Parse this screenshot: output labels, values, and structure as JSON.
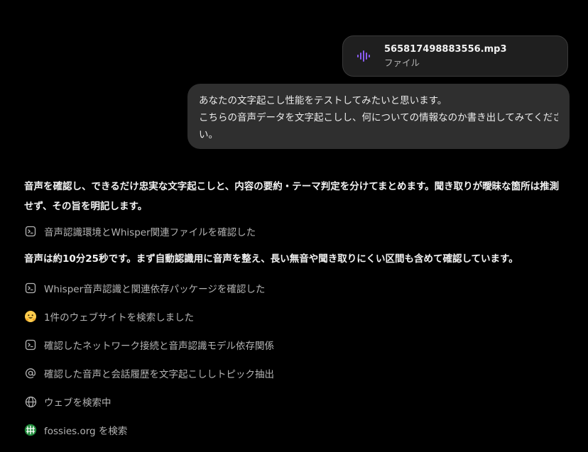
{
  "attachment": {
    "file_name": "565817498883556.mp3",
    "file_type": "ファイル",
    "icon": "audio-waveform-icon",
    "icon_color": "#8b5cf6"
  },
  "user_message": {
    "lines": [
      "あなたの文字起こし性能をテストしてみたいと思います。",
      "こちらの音声データを文字起こしし、何についての情報なのか書き出してみてくださ",
      "い。"
    ]
  },
  "assistant": {
    "intro_lines": [
      "音声を確認し、できるだけ忠実な文字起こしと、内容の要約・テーマ判定を分けてまとめます。聞き取りが曖昧な箇所は推測",
      "せず、その旨を明記します。"
    ],
    "duration_note": "音声は約10分25秒です。まず自動認識用に音声を整え、長い無音や聞き取りにくい区間も含めて確認しています。",
    "steps": [
      {
        "icon": "terminal-icon",
        "label": "音声認識環境とWhisper関連ファイルを確認した"
      },
      {
        "icon": "terminal-icon",
        "label": "Whisper音声認識と関連依存パッケージを確認した"
      },
      {
        "icon": "hugging-face-icon",
        "label": "1件のウェブサイトを検索しました"
      },
      {
        "icon": "terminal-icon",
        "label": "確認したネットワーク接続と音声認識モデル依存関係"
      },
      {
        "icon": "at-sign-icon",
        "label": "確認した音声と会話履歴を文字起こししトピック抽出"
      },
      {
        "icon": "globe-icon",
        "label": "ウェブを検索中"
      },
      {
        "icon": "fossies-icon",
        "label": "fossies.org を検索"
      }
    ]
  },
  "colors": {
    "background": "#000000",
    "bubble": "#2f2f2f",
    "card": "#1f1f1f",
    "muted_text": "#b4b4b4"
  }
}
